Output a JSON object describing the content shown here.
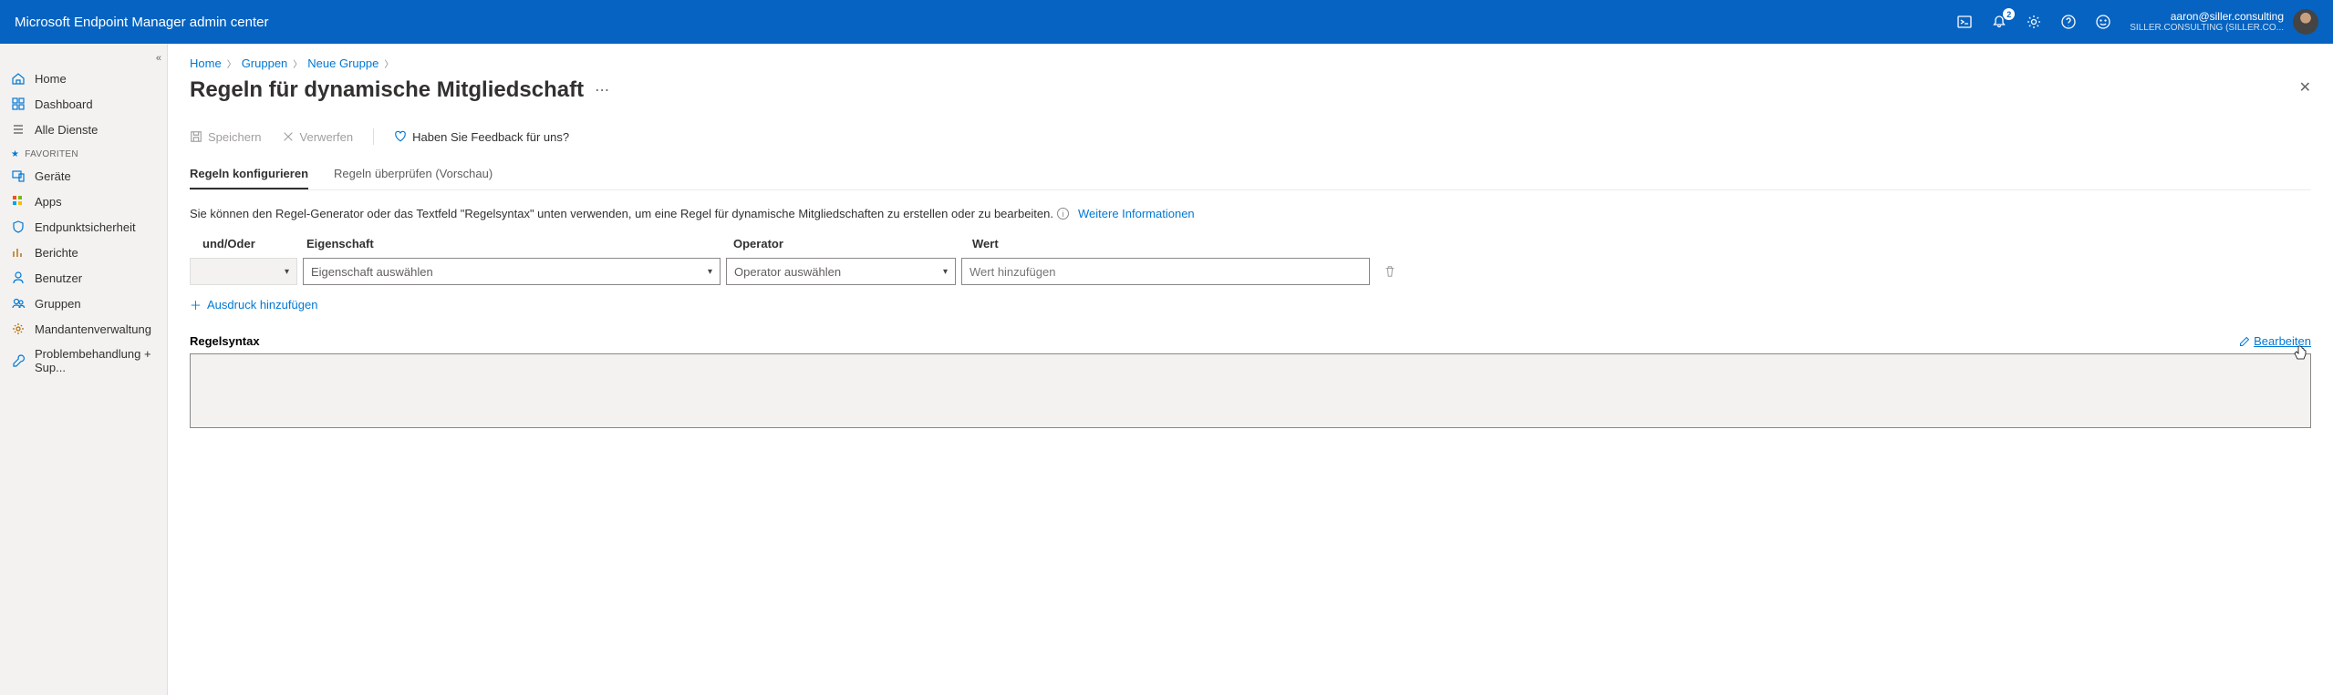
{
  "header": {
    "brand": "Microsoft Endpoint Manager admin center",
    "notification_count": "2",
    "account_email": "aaron@siller.consulting",
    "account_org": "SILLER.CONSULTING (SILLER.CO..."
  },
  "sidebar": {
    "items": [
      {
        "label": "Home",
        "icon": "home"
      },
      {
        "label": "Dashboard",
        "icon": "dashboard"
      },
      {
        "label": "Alle Dienste",
        "icon": "list"
      }
    ],
    "favorites_label": "FAVORITEN",
    "favorites": [
      {
        "label": "Geräte",
        "icon": "devices"
      },
      {
        "label": "Apps",
        "icon": "grid"
      },
      {
        "label": "Endpunktsicherheit",
        "icon": "shield"
      },
      {
        "label": "Berichte",
        "icon": "chart"
      },
      {
        "label": "Benutzer",
        "icon": "user"
      },
      {
        "label": "Gruppen",
        "icon": "group"
      },
      {
        "label": "Mandantenverwaltung",
        "icon": "gear"
      },
      {
        "label": "Problembehandlung + Sup...",
        "icon": "wrench"
      }
    ]
  },
  "breadcrumb": {
    "items": [
      "Home",
      "Gruppen",
      "Neue Gruppe"
    ]
  },
  "page": {
    "title": "Regeln für dynamische Mitgliedschaft",
    "save_label": "Speichern",
    "discard_label": "Verwerfen",
    "feedback_label": "Haben Sie Feedback für uns?",
    "tab_configure": "Regeln konfigurieren",
    "tab_validate": "Regeln überprüfen (Vorschau)",
    "info_text": "Sie können den Regel-Generator oder das Textfeld \"Regelsyntax\" unten verwenden, um eine Regel für dynamische Mitgliedschaften zu erstellen oder zu bearbeiten.",
    "info_link": "Weitere Informationen",
    "col_andor": "und/Oder",
    "col_property": "Eigenschaft",
    "col_operator": "Operator",
    "col_value": "Wert",
    "placeholder_property": "Eigenschaft auswählen",
    "placeholder_operator": "Operator auswählen",
    "placeholder_value": "Wert hinzufügen",
    "add_expression": "Ausdruck hinzufügen",
    "syntax_label": "Regelsyntax",
    "edit_label": "Bearbeiten"
  }
}
